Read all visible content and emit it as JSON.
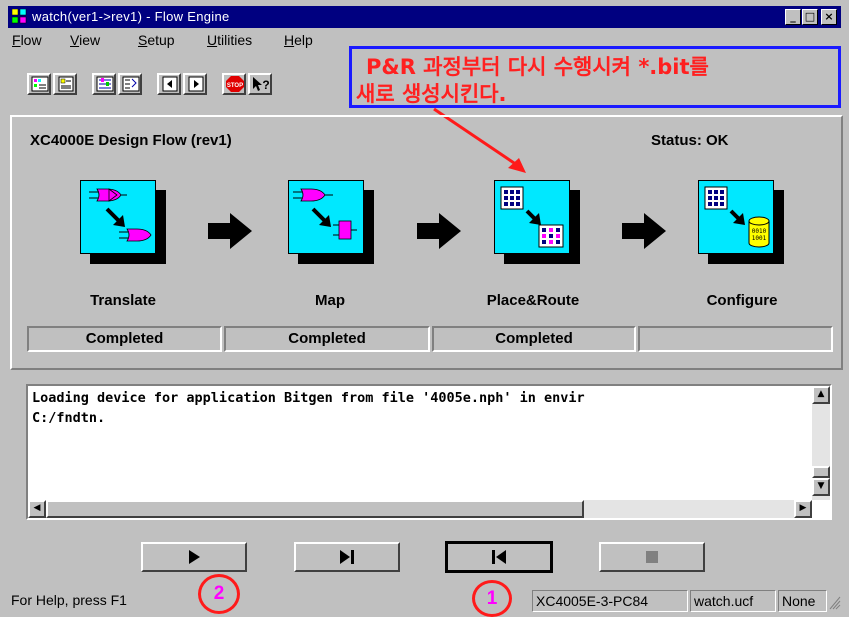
{
  "window": {
    "title": "watch(ver1->rev1) - Flow Engine",
    "minimize": "_",
    "maximize": "□",
    "close": "×"
  },
  "menu": [
    "Flow",
    "View",
    "Setup",
    "Utilities",
    "Help"
  ],
  "toolbar": [
    "step-icon",
    "report-icon",
    "options-icon",
    "implementation-icon",
    "back-icon",
    "forward-icon",
    "stop-icon",
    "help-icon"
  ],
  "annotation": {
    "line1": "P&R 과정부터 다시 수행시켜 *.bit를",
    "line2": "새로 생성시킨다."
  },
  "flow": {
    "title": "XC4000E Design Flow (rev1)",
    "status": "Status: OK",
    "steps": [
      {
        "label": "Translate",
        "state": "Completed"
      },
      {
        "label": "Map",
        "state": "Completed"
      },
      {
        "label": "Place&Route",
        "state": "Completed"
      },
      {
        "label": "Configure",
        "state": ""
      }
    ]
  },
  "log": {
    "lines": [
      "Loading device for application Bitgen from file '4005e.nph' in envir",
      "C:/fndtn."
    ]
  },
  "controls": [
    "play-button",
    "step-button",
    "rewind-button",
    "stop-button"
  ],
  "markers": {
    "m1": "1",
    "m2": "2"
  },
  "statusbar": {
    "help": "For Help, press F1",
    "device": "XC4005E-3-PC84",
    "ucf": "watch.ucf",
    "mode": "None"
  },
  "colors": {
    "titlebar": "#000080",
    "icon_face": "#00e8ff",
    "annotation_border": "#1a1aff",
    "annotation_text": "#ff2020",
    "marker": "#ff1a1a",
    "marker_text": "#ff00ff"
  }
}
